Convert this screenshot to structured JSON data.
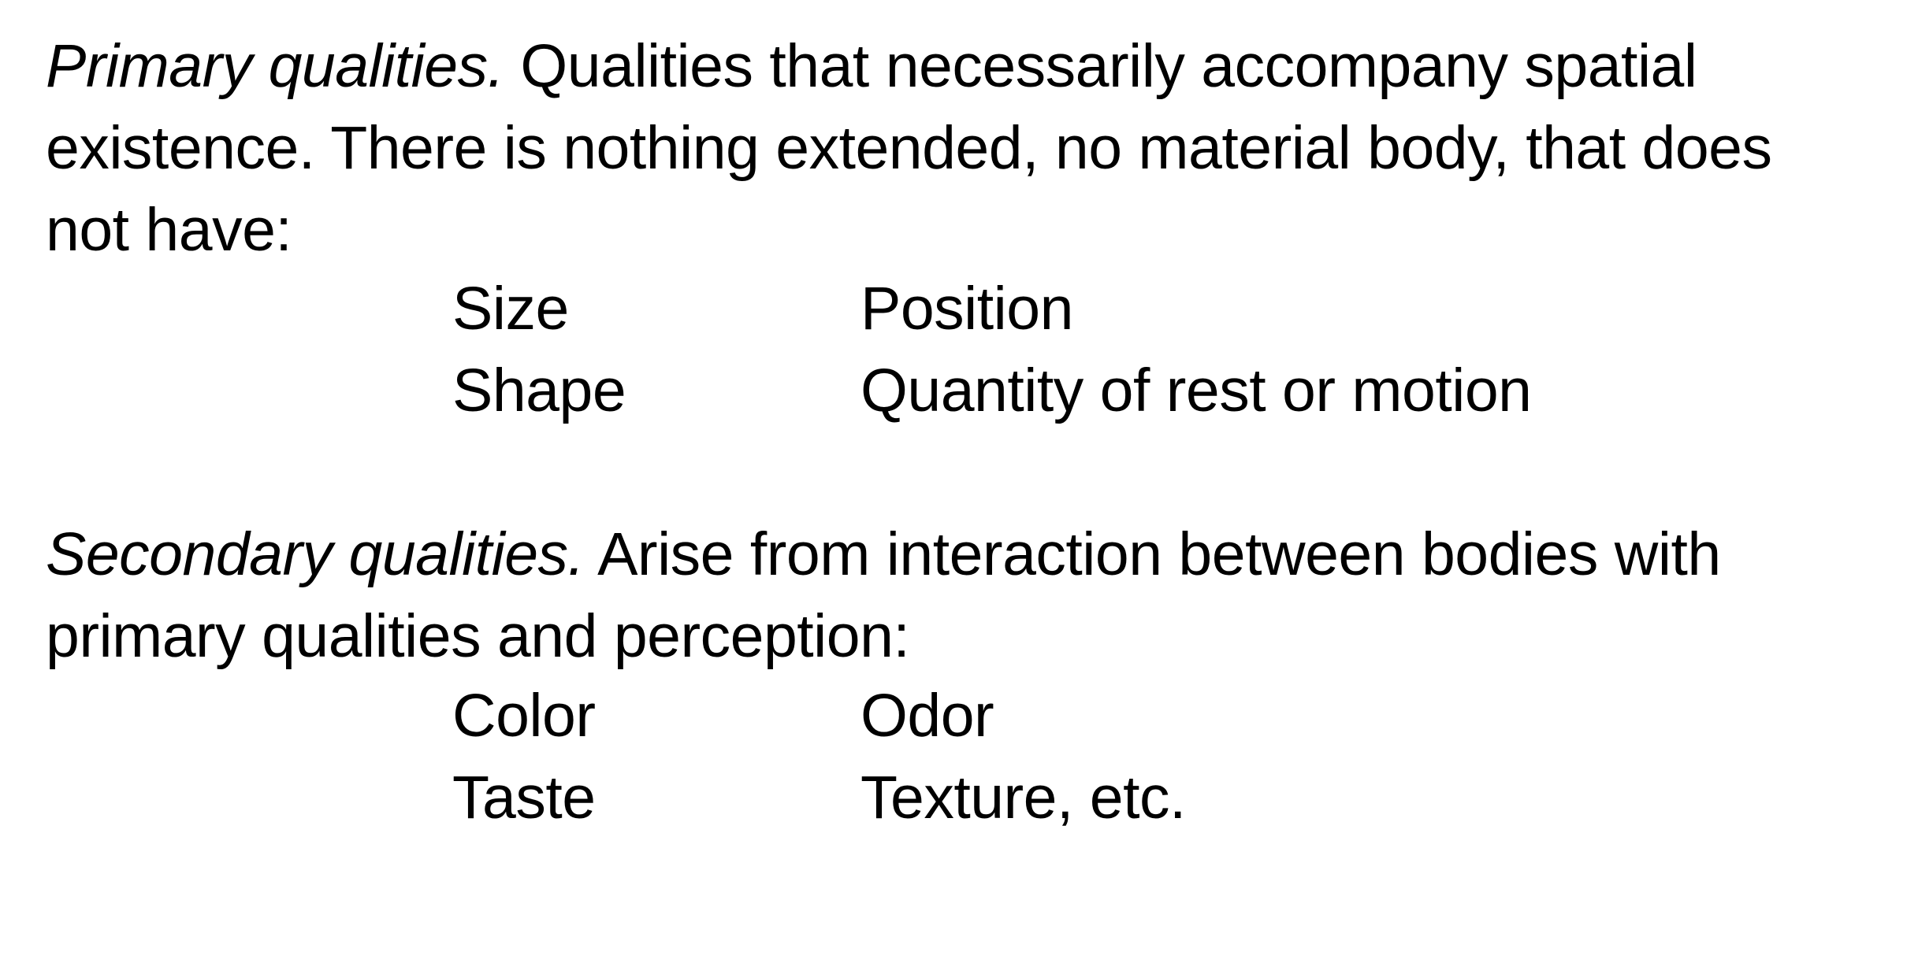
{
  "primary": {
    "term": "Primary qualities.",
    "text": " Qualities that necessarily accompany spatial existence. There is nothing extended, no material body, that does not have:",
    "items": [
      [
        "Size",
        "Position"
      ],
      [
        "Shape",
        "Quantity of rest or motion"
      ]
    ]
  },
  "secondary": {
    "term": "Secondary qualities.",
    "text": " Arise from interaction between bodies with primary qualities and perception:",
    "items": [
      [
        "Color",
        "Odor"
      ],
      [
        "Taste",
        "Texture, etc."
      ]
    ]
  }
}
